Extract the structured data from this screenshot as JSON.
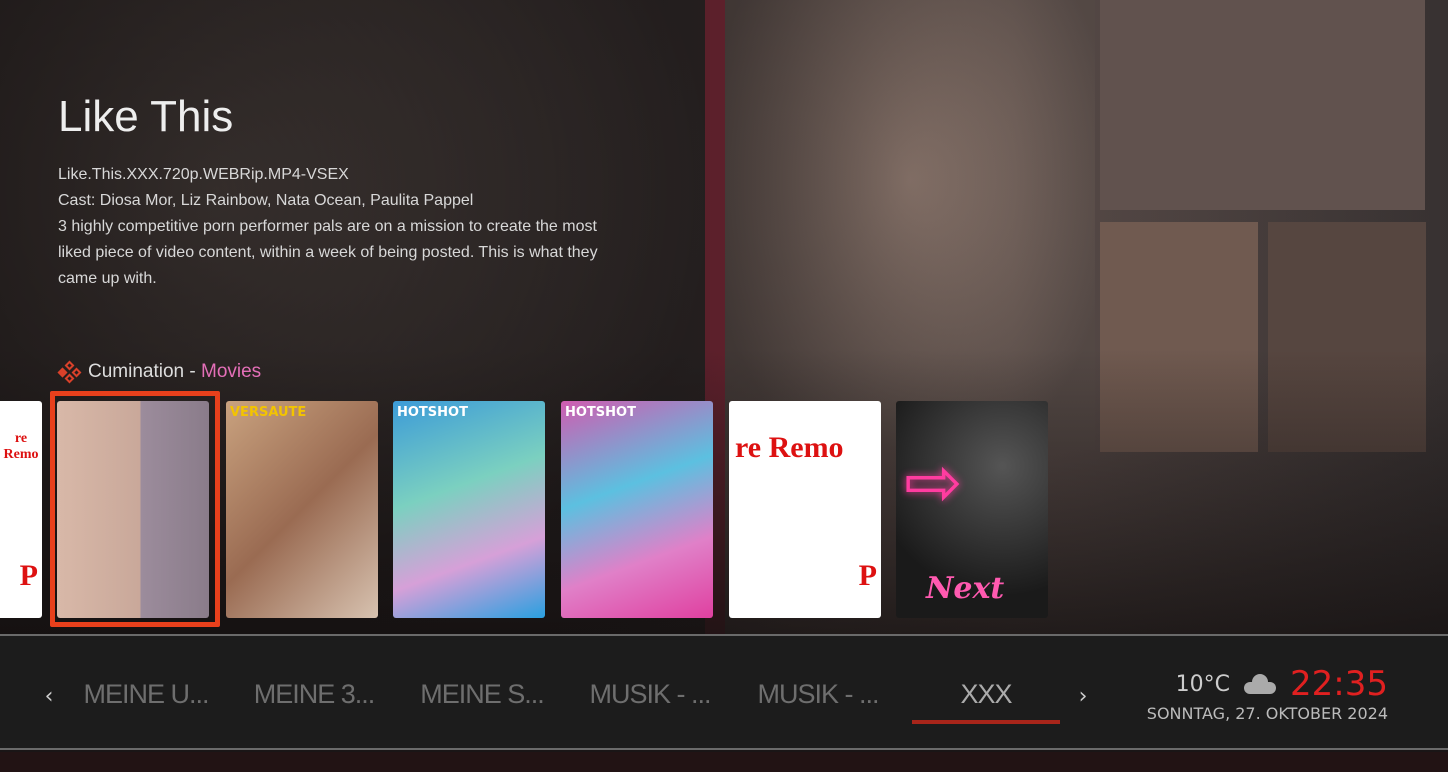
{
  "media": {
    "title": "Like This",
    "filename": "Like.This.XXX.720p.WEBRip.MP4-VSEX",
    "cast": "Cast: Diosa Mor, Liz Rainbow, Nata Ocean, Paulita Pappel",
    "plot": "3 highly competitive porn performer pals are on a mission to create the most liked piece of video content, within a week of being posted. This is what they came up with."
  },
  "category": {
    "addon": "Cumination",
    "separator": " - ",
    "section": "Movies",
    "icon": "kodi-icon"
  },
  "posters": [
    {
      "label": "re Remo",
      "type": "placeholder"
    },
    {
      "label": "",
      "type": "cover",
      "focused": true
    },
    {
      "label": "VERSAUTE",
      "type": "cover"
    },
    {
      "label": "HOTSHOT",
      "type": "cover"
    },
    {
      "label": "HOTSHOT",
      "type": "cover"
    },
    {
      "label": "re Remo",
      "type": "placeholder"
    },
    {
      "label": "Next",
      "type": "next"
    }
  ],
  "menu": {
    "items": [
      "MEINE U...",
      "MEINE 3...",
      "MEINE S...",
      "MUSIK - ...",
      "MUSIK - ...",
      "XXX"
    ],
    "active": "XXX"
  },
  "status": {
    "temperature": "10°C",
    "weather_icon": "cloud-icon",
    "time": "22:35",
    "date": "SONNTAG, 27. OKTOBER 2024"
  },
  "colors": {
    "accent": "#e8401c",
    "time": "#e02020",
    "section": "#e46fb8"
  }
}
